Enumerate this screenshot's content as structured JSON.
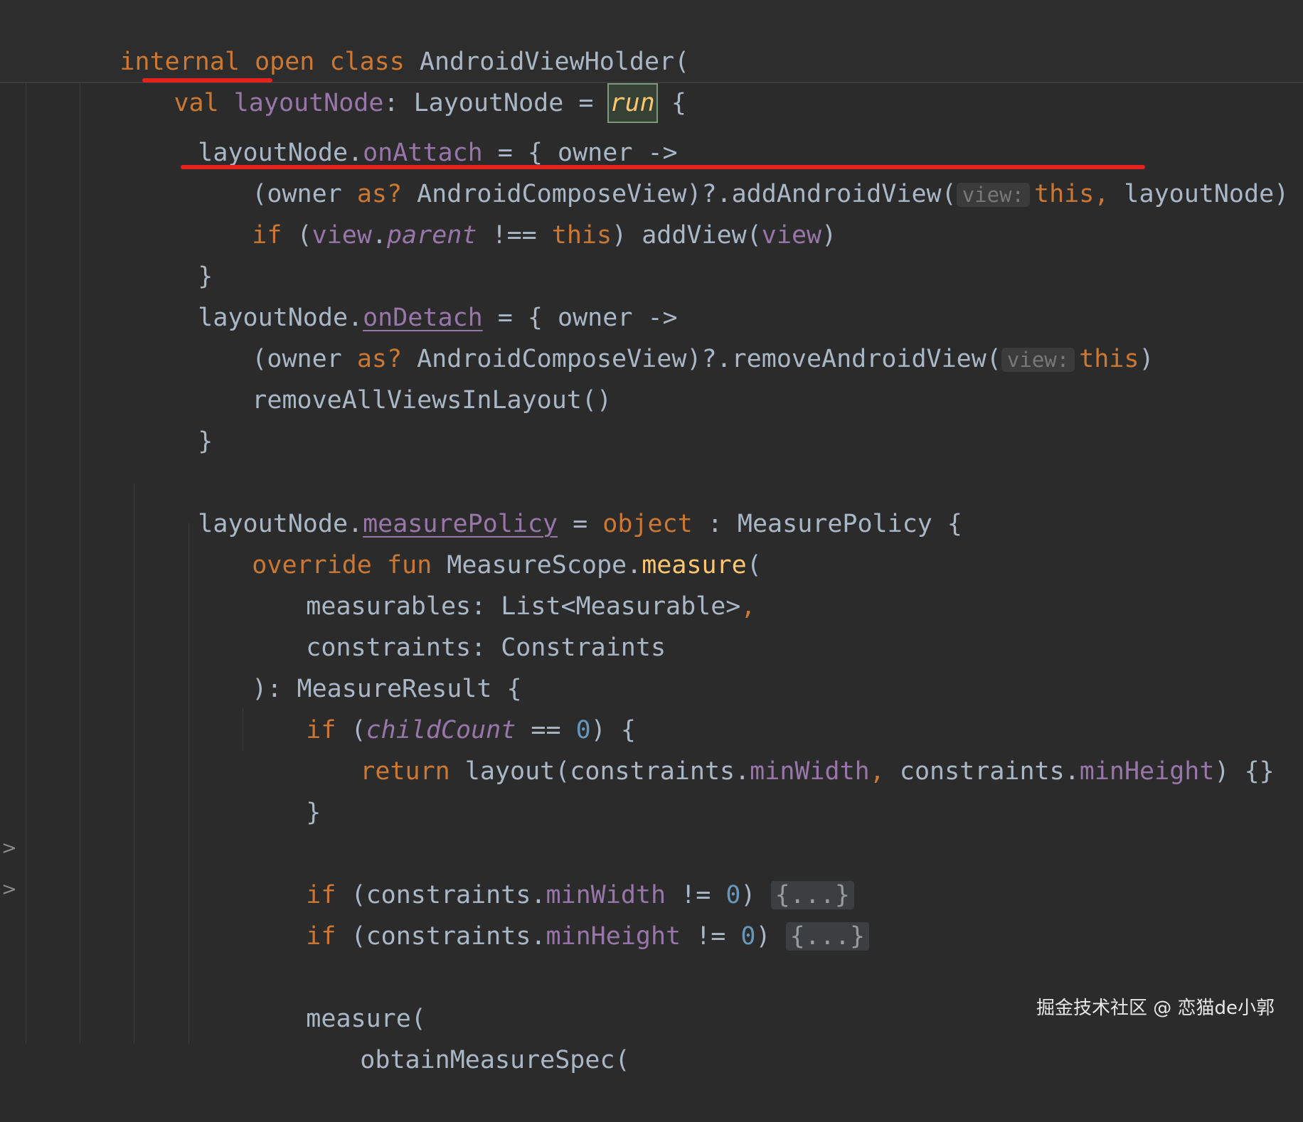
{
  "sticky_header": {
    "l1": {
      "k_internal": "internal",
      "sp1": " ",
      "k_open": "open",
      "sp2": " ",
      "k_class": "class",
      "sp3": " ",
      "name": "AndroidViewHolder("
    },
    "l2": {
      "k_val": "val",
      "sp1": " ",
      "prop": "layoutNode",
      "colon": ": LayoutNode = ",
      "run": "run",
      "brace": " {"
    }
  },
  "code": {
    "l3": {
      "recv": "layoutNode.",
      "prop": "onAttach",
      "rest": " = { owner ->"
    },
    "l4": {
      "a": "(owner ",
      "as": "as?",
      "b": " AndroidComposeView)?.addAndroidView(",
      "hint": "view:",
      "this": "this,",
      "c": " layoutNode)"
    },
    "l5": {
      "if": "if",
      "a": " (",
      "view": "view",
      "dot": ".",
      "parent": "parent",
      "b": " !== ",
      "this": "this",
      "c": ") addView(",
      "view2": "view",
      "d": ")"
    },
    "l6": {
      "a": "}"
    },
    "l7": {
      "recv": "layoutNode.",
      "prop": "onDetach",
      "rest": " = { owner ->"
    },
    "l8": {
      "a": "(owner ",
      "as": "as?",
      "b": " AndroidComposeView)?.removeAndroidView(",
      "hint": "view:",
      "this": "this",
      "c": ")"
    },
    "l9": {
      "a": "removeAllViewsInLayout()"
    },
    "l10": {
      "a": "}"
    },
    "l12": {
      "recv": "layoutNode.",
      "prop": "measurePolicy",
      "a": " = ",
      "object": "object",
      "b": " : MeasurePolicy {"
    },
    "l13": {
      "override": "override",
      "sp": " ",
      "fun": "fun",
      "a": " MeasureScope.",
      "measure": "measure",
      "b": "("
    },
    "l14": {
      "a": "measurables: List<Measurable>",
      "comma": ","
    },
    "l15": {
      "a": "constraints: Constraints"
    },
    "l16": {
      "a": "): MeasureResult {"
    },
    "l17": {
      "if": "if",
      "a": " (",
      "childCount": "childCount",
      "b": " == ",
      "zero": "0",
      "c": ") {"
    },
    "l18": {
      "return": "return",
      "a": " layout(constraints.",
      "minWidth": "minWidth",
      "comma": ",",
      "b": " constraints.",
      "minHeight": "minHeight",
      "c": ") {}"
    },
    "l19": {
      "a": "}"
    },
    "l21": {
      "if": "if",
      "a": " (constraints.",
      "minWidth": "minWidth",
      "b": " != ",
      "zero": "0",
      "c": ") ",
      "fold": "{...}"
    },
    "l22": {
      "if": "if",
      "a": " (constraints.",
      "minHeight": "minHeight",
      "b": " != ",
      "zero": "0",
      "c": ") ",
      "fold": "{...}"
    },
    "l24": {
      "a": "measure("
    },
    "l25": {
      "a": "obtainMeasureSpec("
    }
  },
  "gutter": {
    "fold_chevron": ">"
  },
  "watermark": "掘金技术社区 @ 恋猫de小郭",
  "colors": {
    "background": "#2b2b2b",
    "keyword": "#cc7832",
    "property": "#9876aa",
    "function": "#ffc66d",
    "number": "#6897bb",
    "text": "#a9b7c6",
    "annotation_red": "#e5221c"
  }
}
